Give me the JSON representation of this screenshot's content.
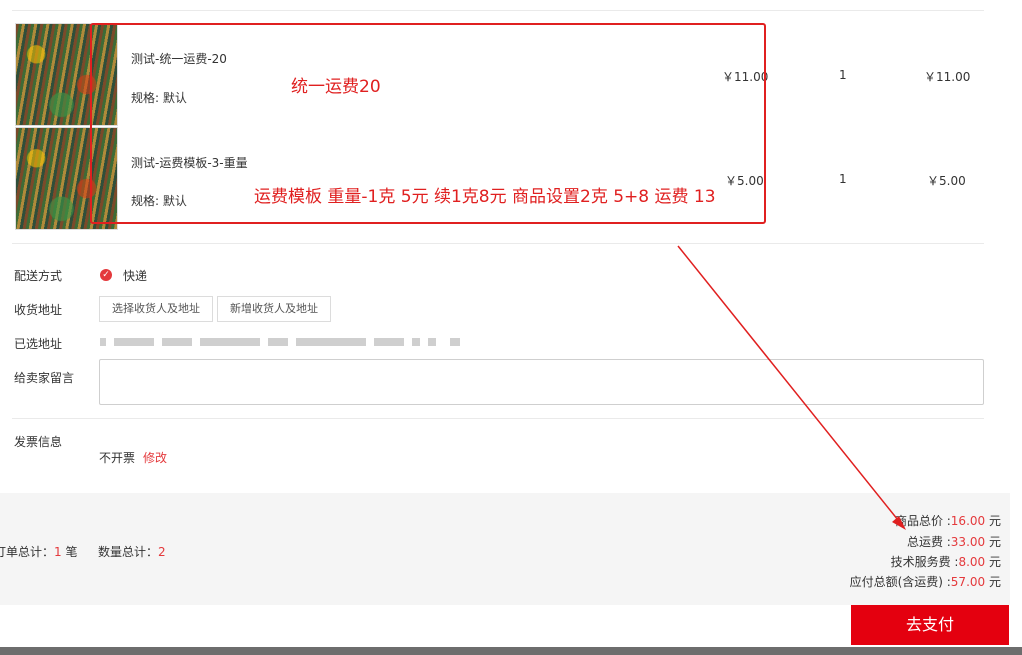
{
  "products": [
    {
      "name": "测试-统一运费-20",
      "spec": "规格: 默认",
      "price": "￥11.00",
      "qty": "1",
      "subtotal": "￥11.00"
    },
    {
      "name": "测试-运费模板-3-重量",
      "spec": "规格: 默认",
      "price": "￥5.00",
      "qty": "1",
      "subtotal": "￥5.00"
    }
  ],
  "annotations": {
    "note1": "统一运费20",
    "note2": "运费模板 重量-1克 5元 续1克8元  商品设置2克  5+8 运费 13"
  },
  "delivery": {
    "label": "配送方式",
    "option": "快递"
  },
  "address": {
    "label": "收货地址",
    "select_btn": "选择收货人及地址",
    "add_btn": "新增收货人及地址",
    "selected_label": "已选地址"
  },
  "message": {
    "label": "给卖家留言",
    "value": ""
  },
  "invoice": {
    "label": "发票信息",
    "value": "不开票",
    "edit": "修改"
  },
  "summary": {
    "order_count_label": "订单总计：",
    "order_count": "1",
    "order_unit": "笔",
    "qty_label": "数量总计：",
    "qty": "2",
    "goods_total_label": "商品总价 :",
    "goods_total": "16.00",
    "shipping_label": "总运费 :",
    "shipping": "33.00",
    "service_label": "技术服务费 :",
    "service": "8.00",
    "payable_label": "应付总额(含运费) :",
    "payable": "57.00",
    "unit": "元"
  },
  "pay_button": "去支付",
  "colors": {
    "accent": "#e4393c",
    "annotation": "#e02020",
    "pay": "#e4000f"
  }
}
